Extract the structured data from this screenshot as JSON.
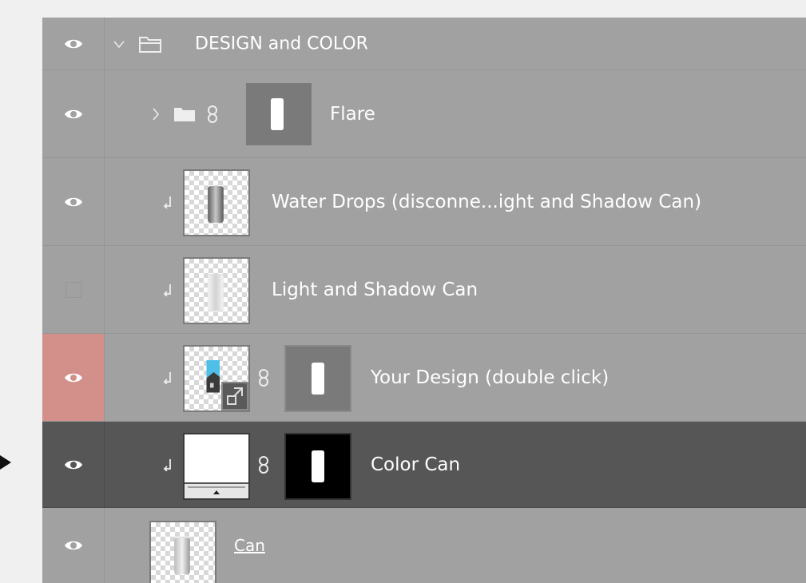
{
  "layers": [
    {
      "name": "DESIGN and COLOR",
      "visible": true,
      "type": "group",
      "expanded": true
    },
    {
      "name": "Flare",
      "visible": true,
      "type": "group",
      "expanded": false,
      "has_mask": true
    },
    {
      "name": "Water Drops (disconne...ight and Shadow  Can)",
      "visible": true,
      "type": "layer",
      "clipped": true
    },
    {
      "name": "Light and Shadow  Can",
      "visible": false,
      "type": "layer",
      "clipped": true
    },
    {
      "name": "Your Design (double click)",
      "visible": true,
      "type": "smart-object",
      "clipped": true,
      "has_mask": true,
      "eye_highlight_color": "#d3908b"
    },
    {
      "name": "Color Can",
      "visible": true,
      "type": "fill-layer",
      "clipped": true,
      "has_mask": true,
      "selected": true
    },
    {
      "name": "Can",
      "visible": true,
      "type": "layer",
      "underlined": true
    }
  ],
  "colors": {
    "panel": "#a1a1a1",
    "selected": "#565656",
    "red_eye": "#d3908b",
    "pointer": "#111111"
  }
}
